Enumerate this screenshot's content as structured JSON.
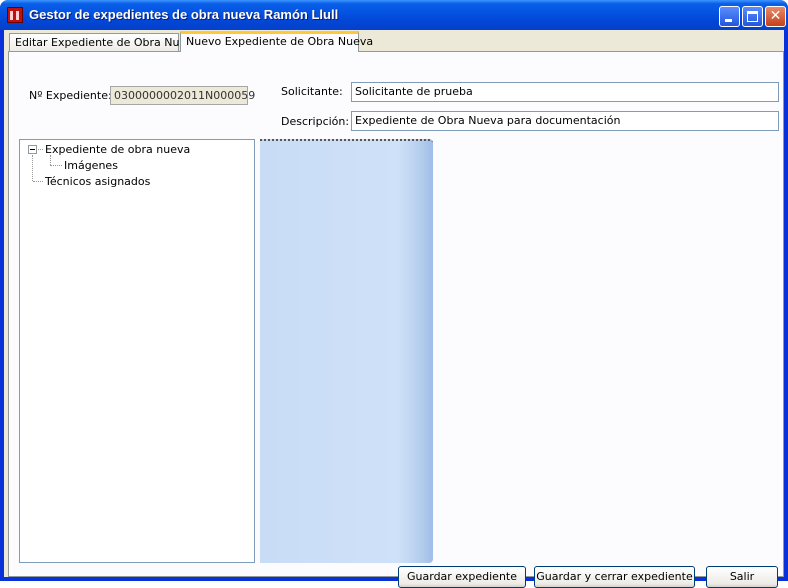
{
  "window": {
    "title": "Gestor de expedientes de obra nueva Ramón Llull",
    "close_glyph": "✕"
  },
  "tabs": [
    {
      "label": "Editar Expediente de Obra Nueva"
    },
    {
      "label": "Nuevo Expediente de Obra Nueva",
      "active": true
    }
  ],
  "form": {
    "expediente_label": "Nº Expediente:",
    "expediente_value": "0300000002011N000059",
    "solicitante_label": "Solicitante:",
    "solicitante_value": "Solicitante de prueba",
    "descripcion_label": "Descripción:",
    "descripcion_value": "Expediente de Obra Nueva para documentación"
  },
  "tree": {
    "root": "Expediente de obra nueva",
    "child": "Imágenes",
    "sibling": "Técnicos asignados"
  },
  "buttons": {
    "save": "Guardar expediente",
    "save_close": "Guardar y cerrar expediente",
    "exit": "Salir"
  },
  "colors": {
    "titlebar": "#0554e3",
    "client_bg": "#ece9d8",
    "active_tab_accent": "#ffc83c",
    "splitter_panel": "#c8dcf6"
  }
}
